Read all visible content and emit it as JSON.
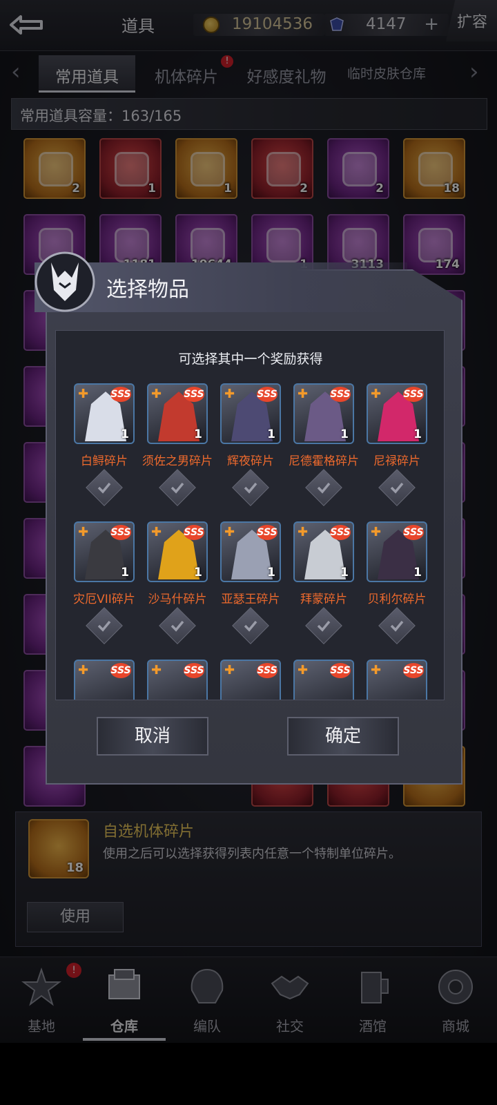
{
  "header": {
    "title": "道具",
    "gold_amount": "19104536",
    "gem_amount": "4147",
    "add_label": "+",
    "expand_label": "扩容"
  },
  "tabs": [
    {
      "label": "常用道具"
    },
    {
      "label": "机体碎片",
      "badge": "!"
    },
    {
      "label": "好感度礼物"
    },
    {
      "label": "临时皮肤仓库"
    }
  ],
  "capacity": "常用道具容量：163/165",
  "inventory": [
    {
      "count": "2"
    },
    {
      "count": "1"
    },
    {
      "count": "1"
    },
    {
      "count": "2"
    },
    {
      "count": "2"
    },
    {
      "count": "18"
    },
    {
      "count": "1181"
    },
    {
      "count": "10644"
    },
    {
      "count": "1"
    },
    {
      "count": "3113"
    },
    {
      "count": "174"
    }
  ],
  "detail": {
    "title": "自选机体碎片",
    "description": "使用之后可以选择获得列表内任意一个特制单位碎片。",
    "count": "18",
    "use_label": "使用"
  },
  "nav": {
    "items": [
      {
        "label": "基地",
        "icon": "base-icon",
        "badge": "!"
      },
      {
        "label": "仓库",
        "icon": "warehouse-icon"
      },
      {
        "label": "编队",
        "icon": "formation-icon"
      },
      {
        "label": "社交",
        "icon": "handshake-icon"
      },
      {
        "label": "酒馆",
        "icon": "tavern-icon"
      },
      {
        "label": "商城",
        "icon": "shop-icon"
      }
    ],
    "active": "仓库"
  },
  "dialog": {
    "title": "选择物品",
    "subtitle": "可选择其中一个奖励获得",
    "rarity_label": "SSS",
    "choices": [
      {
        "name": "白鲟碎片",
        "count": "1",
        "color": "#d9dde8"
      },
      {
        "name": "须佐之男碎片",
        "count": "1",
        "color": "#c23a2e"
      },
      {
        "name": "辉夜碎片",
        "count": "1",
        "color": "#4d4a73"
      },
      {
        "name": "尼德霍格碎片",
        "count": "1",
        "color": "#6b5a86"
      },
      {
        "name": "尼禄碎片",
        "count": "1",
        "color": "#d2286a"
      },
      {
        "name": "灾厄VII碎片",
        "count": "1",
        "color": "#3a3a40"
      },
      {
        "name": "沙马什碎片",
        "count": "1",
        "color": "#e0a21a"
      },
      {
        "name": "亚瑟王碎片",
        "count": "1",
        "color": "#9aa0b3"
      },
      {
        "name": "拜蒙碎片",
        "count": "1",
        "color": "#c8ccd3"
      },
      {
        "name": "贝利尔碎片",
        "count": "1",
        "color": "#3b2f45"
      }
    ],
    "cancel_label": "取消",
    "confirm_label": "确定"
  }
}
